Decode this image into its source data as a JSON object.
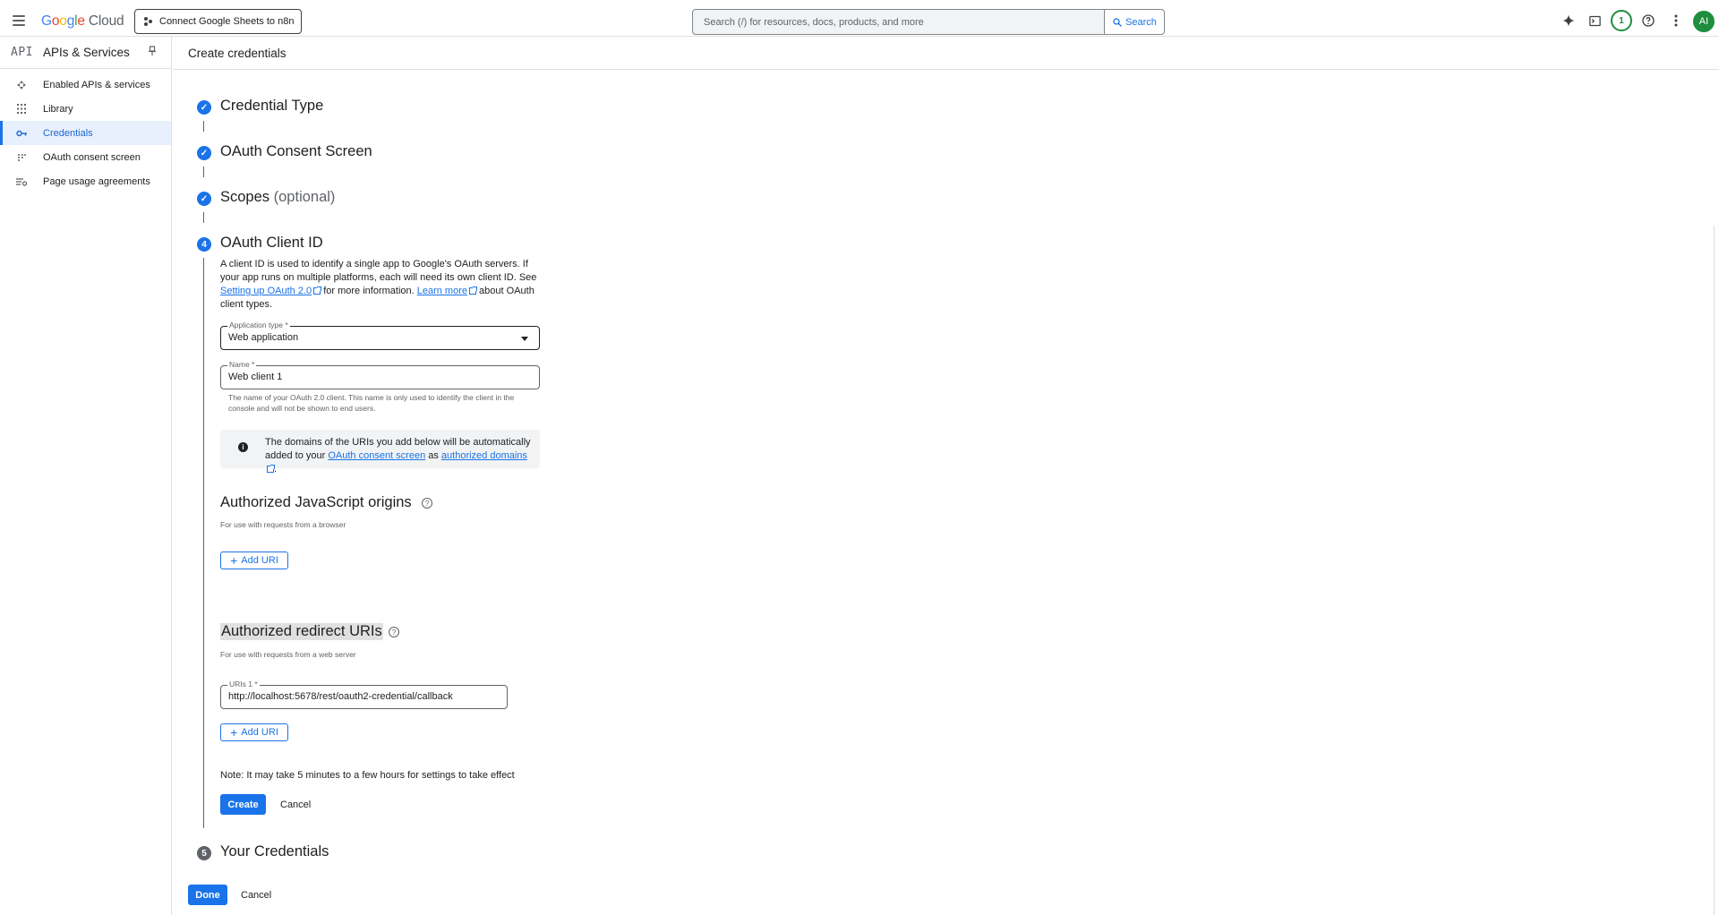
{
  "header": {
    "logo_google": "Google",
    "logo_cloud": "Cloud",
    "project": "Connect Google Sheets to n8n",
    "search_placeholder": "Search (/) for resources, docs, products, and more",
    "search_button": "Search",
    "notification_count": "1",
    "avatar_initials": "AI"
  },
  "sidebar": {
    "api_badge": "API",
    "title": "APIs & Services",
    "items": [
      {
        "label": "Enabled APIs & services",
        "icon": "enabled-apis-icon"
      },
      {
        "label": "Library",
        "icon": "library-icon"
      },
      {
        "label": "Credentials",
        "icon": "key-icon",
        "active": true
      },
      {
        "label": "OAuth consent screen",
        "icon": "consent-icon"
      },
      {
        "label": "Page usage agreements",
        "icon": "agreements-icon"
      }
    ]
  },
  "page": {
    "title": "Create credentials"
  },
  "steps": {
    "credential_type": "Credential Type",
    "consent_screen": "OAuth Consent Screen",
    "scopes": "Scopes",
    "scopes_optional": "(optional)",
    "client_id": "OAuth Client ID",
    "client_id_number": "4",
    "your_credentials": "Your Credentials",
    "your_credentials_number": "5"
  },
  "client_id": {
    "desc_part1": "A client ID is used to identify a single app to Google's OAuth servers. If your app runs on multiple platforms, each will need its own client ID. See ",
    "desc_link1": "Setting up OAuth 2.0",
    "desc_part2": " for more information. ",
    "desc_link2": "Learn more",
    "desc_part3": " about OAuth client types.",
    "app_type_label": "Application type *",
    "app_type_value": "Web application",
    "name_label": "Name *",
    "name_value": "Web client 1",
    "name_hint": "The name of your OAuth 2.0 client. This name is only used to identify the client in the console and will not be shown to end users.",
    "info_part1": "The domains of the URIs you add below will be automatically added to your ",
    "info_link1": "OAuth consent screen",
    "info_part2": " as ",
    "info_link2": "authorized domains",
    "info_part3": "."
  },
  "js_origins": {
    "title": "Authorized JavaScript origins",
    "subtitle": "For use with requests from a browser",
    "add_button": "Add URI"
  },
  "redirect_uris": {
    "title": "Authorized redirect URIs",
    "subtitle": "For use with requests from a web server",
    "uri_label": "URIs 1 *",
    "uri_value": "http://localhost:5678/rest/oauth2-credential/callback",
    "add_button": "Add URI"
  },
  "footer": {
    "note": "Note: It may take 5 minutes to a few hours for settings to take effect",
    "create": "Create",
    "cancel": "Cancel",
    "done": "Done",
    "cancel2": "Cancel"
  },
  "colors": {
    "accent": "#1a73e8",
    "active_bg": "#e8f0fe",
    "avatar": "#1e8e3e"
  }
}
